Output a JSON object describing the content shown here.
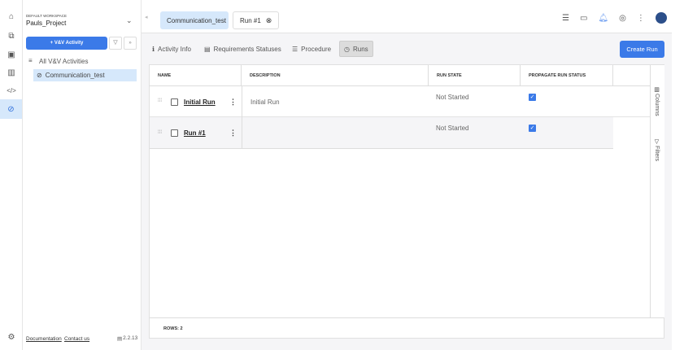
{
  "rail": {
    "icons": [
      "home-icon",
      "hierarchy-icon",
      "clipboard-icon",
      "chart-icon",
      "code-icon",
      "link-icon"
    ],
    "settings": "gear-icon"
  },
  "workspace": {
    "label": "DEFAULT WORKSPACE",
    "name": "Pauls_Project"
  },
  "panel": {
    "add_button": "+ V&V Activity",
    "all_label": "All V&V Activities",
    "selected_item": "Communication_test"
  },
  "footer": {
    "documentation": "Documentation",
    "contact": "Contact us",
    "version": "2.2.13"
  },
  "tabs": [
    {
      "label": "Communication_test",
      "active": true
    },
    {
      "label": "Run #1",
      "active": false
    }
  ],
  "subtabs": [
    "Activity Info",
    "Requirements Statuses",
    "Procedure",
    "Runs"
  ],
  "create_run": "Create Run",
  "table": {
    "columns": [
      "NAME",
      "DESCRIPTION",
      "RUN STATE",
      "PROPAGATE RUN STATUS"
    ],
    "rows": [
      {
        "name": "Initial Run",
        "description": "Initial Run",
        "state": "Not Started",
        "propagate": true
      },
      {
        "name": "Run #1",
        "description": "",
        "state": "Not Started",
        "propagate": true
      }
    ],
    "rows_label": "ROWS: 2",
    "side": [
      "Columns",
      "Filters"
    ]
  },
  "colors": {
    "accent": "#3b7ae8",
    "selected": "#d6e8fb"
  }
}
